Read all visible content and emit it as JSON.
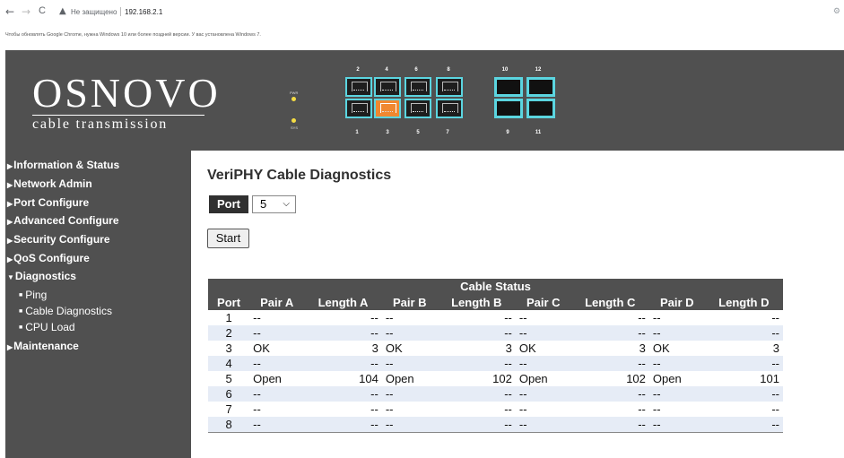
{
  "browser": {
    "back_icon": "←",
    "forward_icon": "→",
    "reload_icon": "C",
    "warning_icon": "▲",
    "security_text": "Не защищено",
    "url": "192.168.2.1",
    "right_icon": "⚙"
  },
  "notice": "Чтобы обновлять Google Chrome, нужна Windows 10 или более поздней версии. У вас установлена Windows 7.",
  "header": {
    "logo_main": "OSNOVO",
    "logo_sub": "cable transmission",
    "led_pwr": "PWR",
    "led_sys": "SYS",
    "port_top_numbers": [
      "2",
      "4",
      "6",
      "8",
      "10",
      "12"
    ],
    "port_bottom_numbers": [
      "1",
      "3",
      "5",
      "7",
      "9",
      "11"
    ]
  },
  "sidebar": {
    "items": [
      {
        "label": "Information & Status",
        "arrow": "▶"
      },
      {
        "label": "Network Admin",
        "arrow": "▶"
      },
      {
        "label": "Port Configure",
        "arrow": "▶"
      },
      {
        "label": "Advanced Configure",
        "arrow": "▶"
      },
      {
        "label": "Security Configure",
        "arrow": "▶"
      },
      {
        "label": "QoS Configure",
        "arrow": "▶"
      },
      {
        "label": "Diagnostics",
        "arrow": "▼"
      },
      {
        "label": "Maintenance",
        "arrow": "▶"
      }
    ],
    "sub_items": [
      {
        "label": "Ping",
        "bullet": "■"
      },
      {
        "label": "Cable Diagnostics",
        "bullet": "■"
      },
      {
        "label": "CPU Load",
        "bullet": "■"
      }
    ]
  },
  "main": {
    "title": "VeriPHY Cable Diagnostics",
    "port_label": "Port",
    "port_value": "5",
    "port_chevron": "⌵",
    "start_label": "Start"
  },
  "table": {
    "group_header": "Cable Status",
    "columns": [
      "Port",
      "Pair A",
      "Length A",
      "Pair B",
      "Length B",
      "Pair C",
      "Length C",
      "Pair D",
      "Length D"
    ],
    "rows": [
      [
        "1",
        "--",
        "--",
        "--",
        "--",
        "--",
        "--",
        "--",
        "--"
      ],
      [
        "2",
        "--",
        "--",
        "--",
        "--",
        "--",
        "--",
        "--",
        "--"
      ],
      [
        "3",
        "OK",
        "3",
        "OK",
        "3",
        "OK",
        "3",
        "OK",
        "3"
      ],
      [
        "4",
        "--",
        "--",
        "--",
        "--",
        "--",
        "--",
        "--",
        "--"
      ],
      [
        "5",
        "Open",
        "104",
        "Open",
        "102",
        "Open",
        "102",
        "Open",
        "101"
      ],
      [
        "6",
        "--",
        "--",
        "--",
        "--",
        "--",
        "--",
        "--",
        "--"
      ],
      [
        "7",
        "--",
        "--",
        "--",
        "--",
        "--",
        "--",
        "--",
        "--"
      ],
      [
        "8",
        "--",
        "--",
        "--",
        "--",
        "--",
        "--",
        "--",
        "--"
      ]
    ]
  },
  "colors": {
    "panel": "#505050",
    "port_border": "#5bd5e0",
    "active_port": "#f08830",
    "led": "#f5dc44",
    "row_alt": "#e6ecf6"
  }
}
